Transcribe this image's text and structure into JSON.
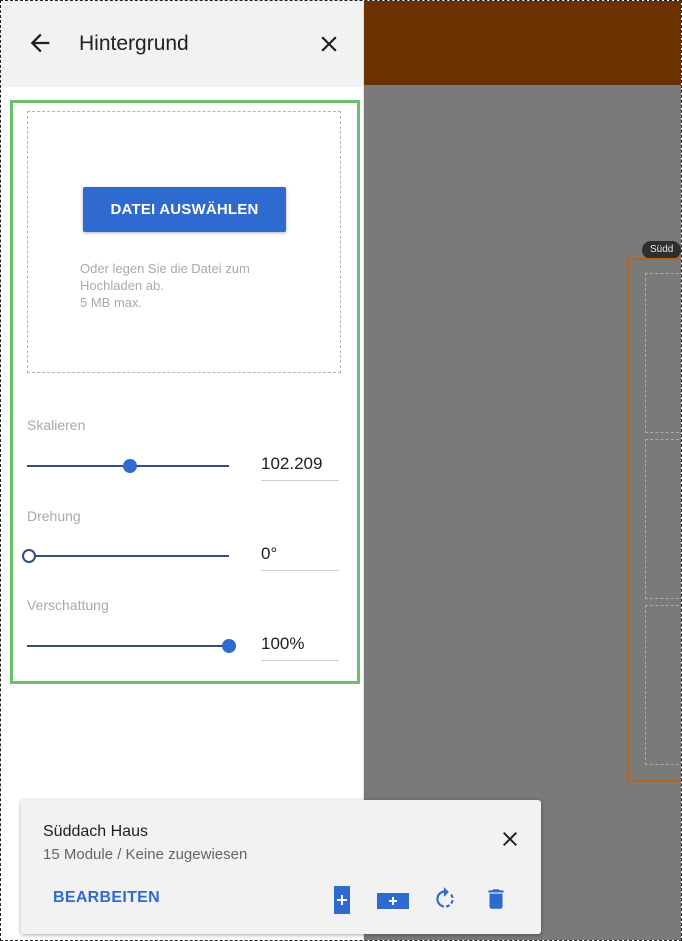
{
  "panel": {
    "title": "Hintergrund"
  },
  "upload": {
    "button_label": "DATEI AUSWÄHLEN",
    "hint_line1": "Oder legen Sie die Datei zum",
    "hint_line2": "Hochladen ab.",
    "hint_line3": "5 MB max."
  },
  "controls": {
    "scale": {
      "label": "Skalieren",
      "value": "102.209",
      "level": 0.51
    },
    "rotation": {
      "label": "Drehung",
      "value": "0°",
      "level": 0.0
    },
    "shading": {
      "label": "Verschattung",
      "value": "100%",
      "level": 1.0
    }
  },
  "roof": {
    "label": "Südd"
  },
  "card": {
    "title": "Süddach Haus",
    "subtitle": "15 Module / Keine zugewiesen",
    "edit_label": "BEARBEITEN"
  },
  "icons": {
    "back": "arrow-left-icon",
    "close": "close-icon",
    "add_portrait": "add-module-portrait-icon",
    "add_landscape": "add-module-landscape-icon",
    "rotate": "rotate-icon",
    "delete": "trash-icon"
  },
  "colors": {
    "accent": "#2f6ad0",
    "highlight": "#69c26b",
    "topbar": "#6b3200",
    "roof_outline": "#b8621a"
  }
}
